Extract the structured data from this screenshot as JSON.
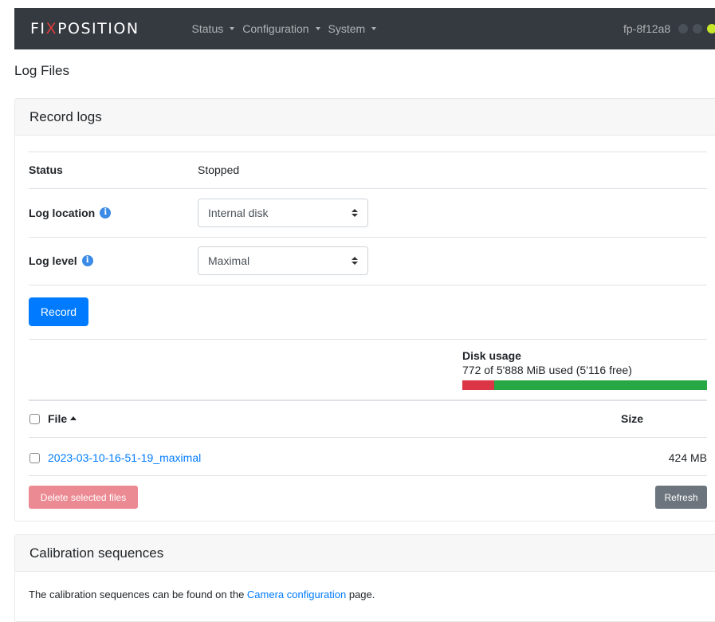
{
  "navbar": {
    "brand_pre": "FI",
    "brand_x": "X",
    "brand_post": "POSITION",
    "menu": [
      {
        "label": "Status"
      },
      {
        "label": "Configuration"
      },
      {
        "label": "System"
      }
    ],
    "hostname": "fp-8f12a8",
    "status_dot_colors": [
      "#4a5057",
      "#4a5057",
      "#c8e72a"
    ]
  },
  "page_title": "Log Files",
  "record_logs": {
    "header": "Record logs",
    "status_label": "Status",
    "status_value": "Stopped",
    "location_label": "Log location",
    "location_value": "Internal disk",
    "level_label": "Log level",
    "level_value": "Maximal",
    "info_icon": "i",
    "record_button": "Record",
    "disk_usage_title": "Disk usage",
    "disk_usage_text": "772 of 5'888 MiB used (5'116 free)",
    "disk_used_fraction": 0.131,
    "table": {
      "col_file": "File",
      "col_size": "Size",
      "rows": [
        {
          "file": "2023-03-10-16-51-19_maximal",
          "size": "424 MB"
        }
      ]
    },
    "delete_button": "Delete selected files",
    "refresh_button": "Refresh"
  },
  "calibration": {
    "header": "Calibration sequences",
    "text_before": "The calibration sequences can be found on the ",
    "link": "Camera configuration",
    "text_after": " page."
  },
  "colors": {
    "navbar_bg": "#343a40",
    "primary": "#007bff",
    "danger": "#dc3545",
    "success": "#28a745",
    "secondary": "#6c757d"
  }
}
